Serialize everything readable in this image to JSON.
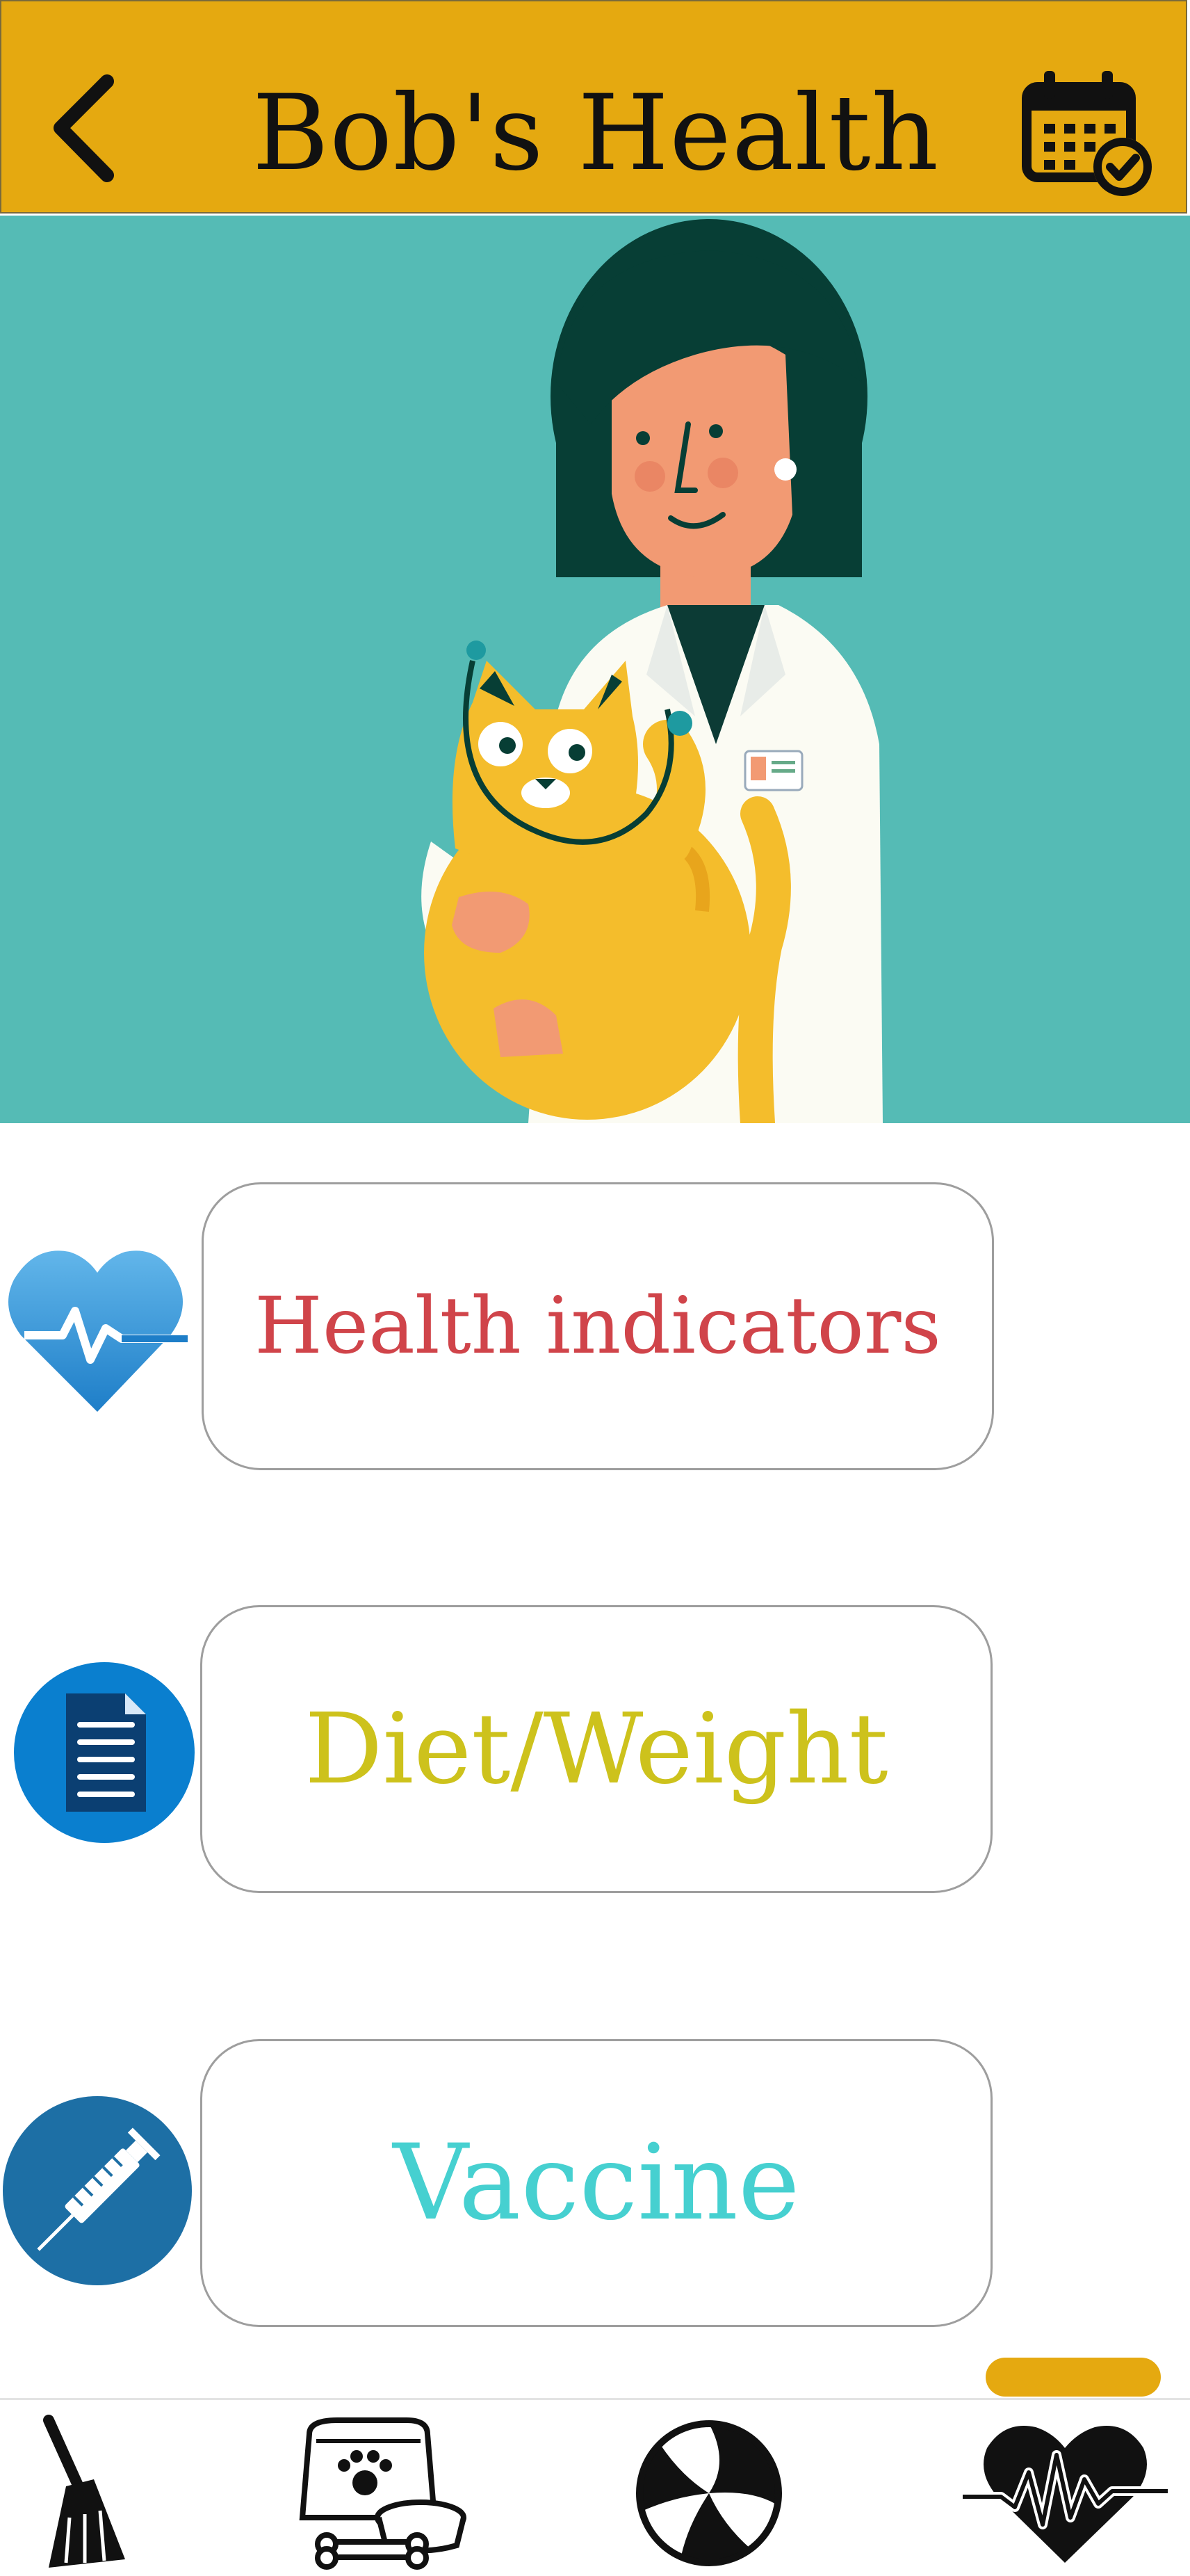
{
  "header": {
    "title": "Bob's Health",
    "back_icon": "chevron-left-icon",
    "calendar_icon": "calendar-check-icon",
    "background_color": "#e5a910"
  },
  "hero": {
    "image": "vet-holding-cat-illustration",
    "background_color": "#55bbb5"
  },
  "menu": [
    {
      "label": "Health indicators",
      "icon": "heart-pulse-icon",
      "color": "#d0444a"
    },
    {
      "label": "Diet/Weight",
      "icon": "document-icon",
      "color": "#cdc21c"
    },
    {
      "label": "Vaccine",
      "icon": "syringe-icon",
      "color": "#46d0d0"
    }
  ],
  "bottom_nav": {
    "tabs": [
      {
        "icon": "broom-icon"
      },
      {
        "icon": "pet-food-icon"
      },
      {
        "icon": "ball-icon"
      },
      {
        "icon": "heartbeat-icon",
        "active": true
      }
    ],
    "active_color": "#e5a910"
  }
}
